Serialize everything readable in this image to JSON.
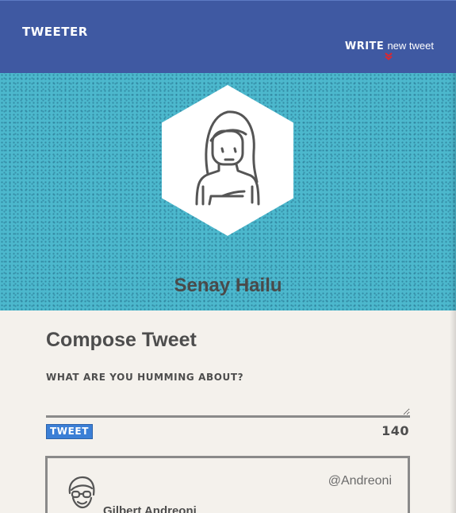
{
  "nav": {
    "brand": "TWEETER",
    "compose_toggle_bold": "WRITE",
    "compose_toggle_rest": "new tweet"
  },
  "profile": {
    "name": "Senay Hailu"
  },
  "compose": {
    "title": "Compose Tweet",
    "label": "WHAT ARE YOU HUMMING ABOUT?",
    "input_value": "",
    "button_label": "TWEET",
    "char_count": "140"
  },
  "tweet": {
    "handle": "@Andreoni",
    "author": "Gilbert Andreoni"
  },
  "colors": {
    "nav_bg": "#3f59a2",
    "hero_bg": "#4cb8cd",
    "page_bg": "#f4f1ec",
    "button_bg": "#3b7fd6",
    "chevron": "#e0262c"
  }
}
